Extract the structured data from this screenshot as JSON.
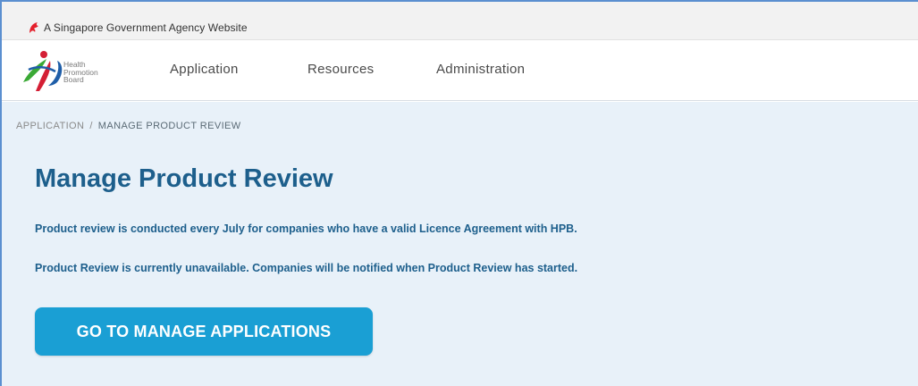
{
  "masthead": {
    "text": "A Singapore Government Agency Website",
    "icon": "singapore-lion-icon"
  },
  "logo": {
    "line1": "Health",
    "line2": "Promotion",
    "line3": "Board",
    "icon": "hpb-logo"
  },
  "nav": {
    "items": [
      {
        "label": "Application"
      },
      {
        "label": "Resources"
      },
      {
        "label": "Administration"
      }
    ]
  },
  "breadcrumb": {
    "parent": "APPLICATION",
    "separator": "/",
    "current": "MANAGE PRODUCT REVIEW"
  },
  "page": {
    "title": "Manage Product Review",
    "paragraph1": "Product review is conducted every July for companies who have a valid Licence Agreement with HPB.",
    "paragraph2": "Product Review is currently unavailable. Companies will be notified when Product Review has started.",
    "button_label": "GO TO MANAGE APPLICATIONS"
  },
  "colors": {
    "accent": "#1a9fd4",
    "heading": "#1d5f8c",
    "content_bg": "#e8f1f9",
    "lion_red": "#e4202c"
  }
}
